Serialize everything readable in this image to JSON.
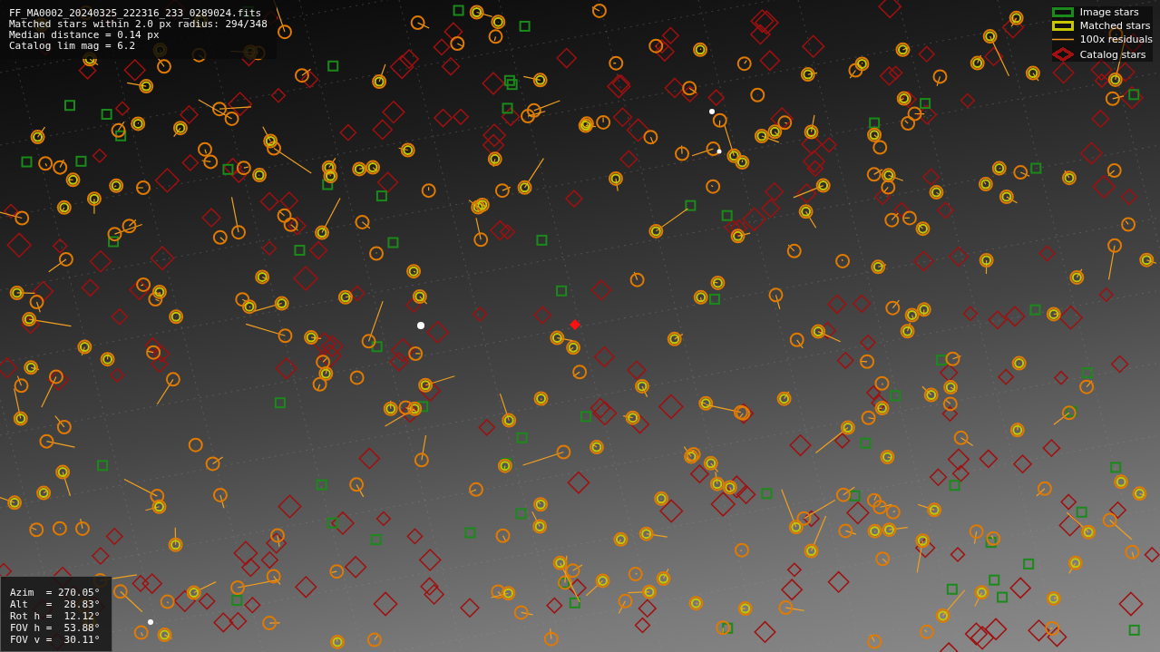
{
  "file_info": {
    "lines": [
      "FF_MA0002_20240325_222316_233_0289024.fits",
      "Matched stars within 2.0 px radius: 294/348",
      "Median distance = 0.14 px",
      "Catalog lim mag = 6.2"
    ]
  },
  "legend": [
    {
      "kind": "box",
      "color": "#1a8a1a",
      "label": "Image stars"
    },
    {
      "kind": "box",
      "color": "#c8c800",
      "label": "Matched stars"
    },
    {
      "kind": "line",
      "color": "#f0a020",
      "label": "100x residuals"
    },
    {
      "kind": "diamond",
      "color": "#a01010",
      "label": "Catalog stars"
    }
  ],
  "pointing": {
    "lines": [
      "Azim  = 270.05°",
      "Alt   =  28.83°",
      "Rot h =  12.12°",
      "FOV h =  53.88°",
      "FOV v =  30.11°"
    ]
  }
}
